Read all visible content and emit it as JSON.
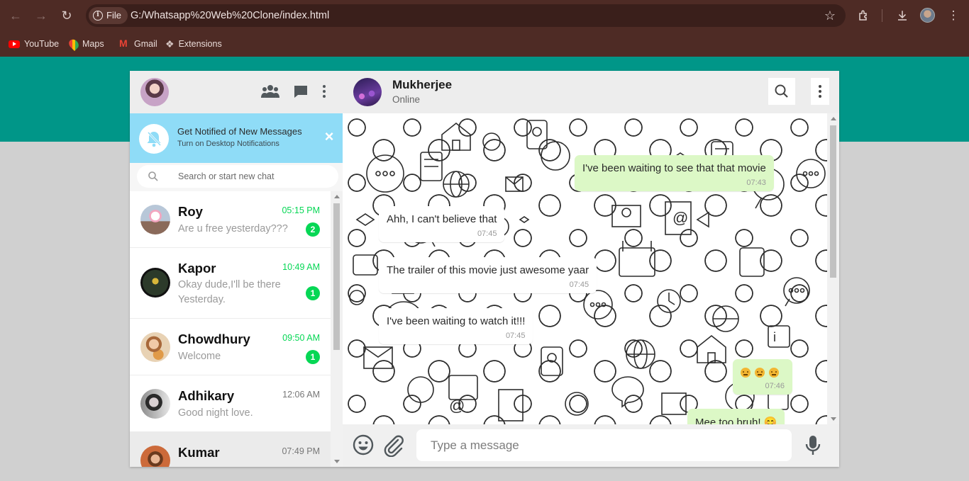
{
  "browser": {
    "chip_label": "File",
    "url": "G:/Whatsapp%20Web%20Clone/index.html",
    "bookmarks": [
      {
        "label": "YouTube",
        "icon": "youtube-icon"
      },
      {
        "label": "Maps",
        "icon": "maps-icon"
      },
      {
        "label": "Gmail",
        "icon": "gmail-icon"
      },
      {
        "label": "Extensions",
        "icon": "puzzle-icon"
      }
    ]
  },
  "colors": {
    "teal_band": "#009688",
    "notification_bg": "#8fdcf7",
    "unread_green": "#06d755",
    "outgoing_bubble": "#dcf8c6",
    "titlebar": "#4e2b25"
  },
  "notification": {
    "title": "Get Notified of New Messages",
    "subtitle": "Turn on Desktop Notifications"
  },
  "search": {
    "placeholder": "Search or start new chat"
  },
  "chats": [
    {
      "name": "Roy",
      "time": "05:15 PM",
      "message": "Are u free yesterday???",
      "unread": "2"
    },
    {
      "name": "Kapor",
      "time": "10:49 AM",
      "message": "Okay dude,I'll be there Yesterday.",
      "unread": "1"
    },
    {
      "name": "Chowdhury",
      "time": "09:50 AM",
      "message": "Welcome",
      "unread": "1"
    },
    {
      "name": "Adhikary",
      "time": "12:06 AM",
      "message": "Good night love.",
      "unread": ""
    },
    {
      "name": "Kumar",
      "time": "07:49 PM",
      "message": "",
      "unread": ""
    }
  ],
  "contact": {
    "name": "Mukherjee",
    "status": "Online"
  },
  "messages": [
    {
      "direction": "out",
      "text": "I've been waiting to see that that movie",
      "time": "07:43"
    },
    {
      "direction": "in",
      "text": "Ahh, I can't believe that",
      "time": "07:45"
    },
    {
      "direction": "in",
      "text": "The trailer of this movie just awesome yaar",
      "time": "07:45"
    },
    {
      "direction": "in",
      "text": "I've been waiting to watch it!!!",
      "time": "07:45"
    },
    {
      "direction": "out",
      "text": "",
      "time": "07:46"
    },
    {
      "direction": "out",
      "text": "Mee too bruh! 😊",
      "time": ""
    }
  ],
  "composer": {
    "placeholder": "Type a message"
  }
}
